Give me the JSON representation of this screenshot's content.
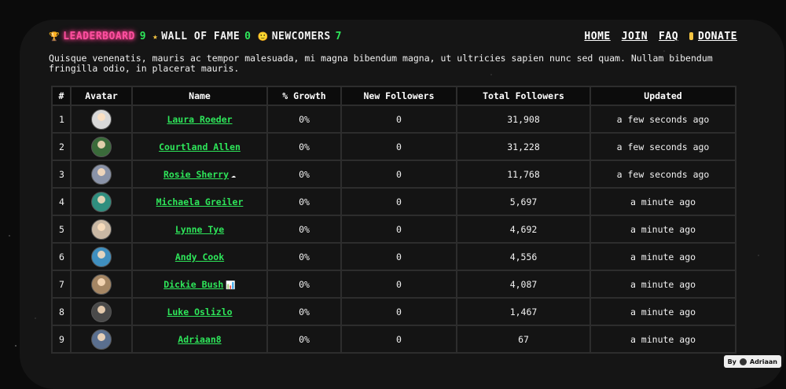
{
  "nav": {
    "left": [
      {
        "icon": "🏆",
        "label": "LEADERBOARD",
        "count": "9"
      },
      {
        "icon": "★",
        "label": "WALL OF FAME",
        "count": "0"
      },
      {
        "icon": "🙂",
        "label": "NEWCOMERS",
        "count": "7"
      }
    ],
    "right": [
      "HOME",
      "JOIN",
      "FAQ",
      "DONATE"
    ]
  },
  "intro": "Quisque venenatis, mauris ac tempor malesuada, mi magna bibendum magna, ut ultricies sapien nunc sed quam. Nullam bibendum fringilla odio, in placerat mauris.",
  "table": {
    "headers": [
      "#",
      "Avatar",
      "Name",
      "% Growth",
      "New Followers",
      "Total Followers",
      "Updated"
    ],
    "rows": [
      {
        "rank": "1",
        "name": "Laura Roeder",
        "emoji": "",
        "growth": "0%",
        "new": "0",
        "total": "31,908",
        "updated": "a few seconds ago",
        "avatar_color": "#d9d9d9"
      },
      {
        "rank": "2",
        "name": "Courtland Allen",
        "emoji": "",
        "growth": "0%",
        "new": "0",
        "total": "31,228",
        "updated": "a few seconds ago",
        "avatar_color": "#3a6b3a"
      },
      {
        "rank": "3",
        "name": "Rosie Sherry",
        "emoji": "☁",
        "growth": "0%",
        "new": "0",
        "total": "11,768",
        "updated": "a few seconds ago",
        "avatar_color": "#8a93a8"
      },
      {
        "rank": "4",
        "name": "Michaela Greiler",
        "emoji": "",
        "growth": "0%",
        "new": "0",
        "total": "5,697",
        "updated": "a minute ago",
        "avatar_color": "#2f8f7f"
      },
      {
        "rank": "5",
        "name": "Lynne Tye",
        "emoji": "",
        "growth": "0%",
        "new": "0",
        "total": "4,692",
        "updated": "a minute ago",
        "avatar_color": "#c9b8a4"
      },
      {
        "rank": "6",
        "name": "Andy Cook",
        "emoji": "",
        "growth": "0%",
        "new": "0",
        "total": "4,556",
        "updated": "a minute ago",
        "avatar_color": "#3f8fbf"
      },
      {
        "rank": "7",
        "name": "Dickie Bush",
        "emoji": "📊",
        "growth": "0%",
        "new": "0",
        "total": "4,087",
        "updated": "a minute ago",
        "avatar_color": "#a58664"
      },
      {
        "rank": "8",
        "name": "Luke Oslizlo",
        "emoji": "",
        "growth": "0%",
        "new": "0",
        "total": "1,467",
        "updated": "a minute ago",
        "avatar_color": "#4a4a4a"
      },
      {
        "rank": "9",
        "name": "Adriaan8",
        "emoji": "",
        "growth": "0%",
        "new": "0",
        "total": "67",
        "updated": "a minute ago",
        "avatar_color": "#5a6f8f"
      }
    ]
  },
  "badge": {
    "by": "By",
    "author": "Adriaan"
  }
}
